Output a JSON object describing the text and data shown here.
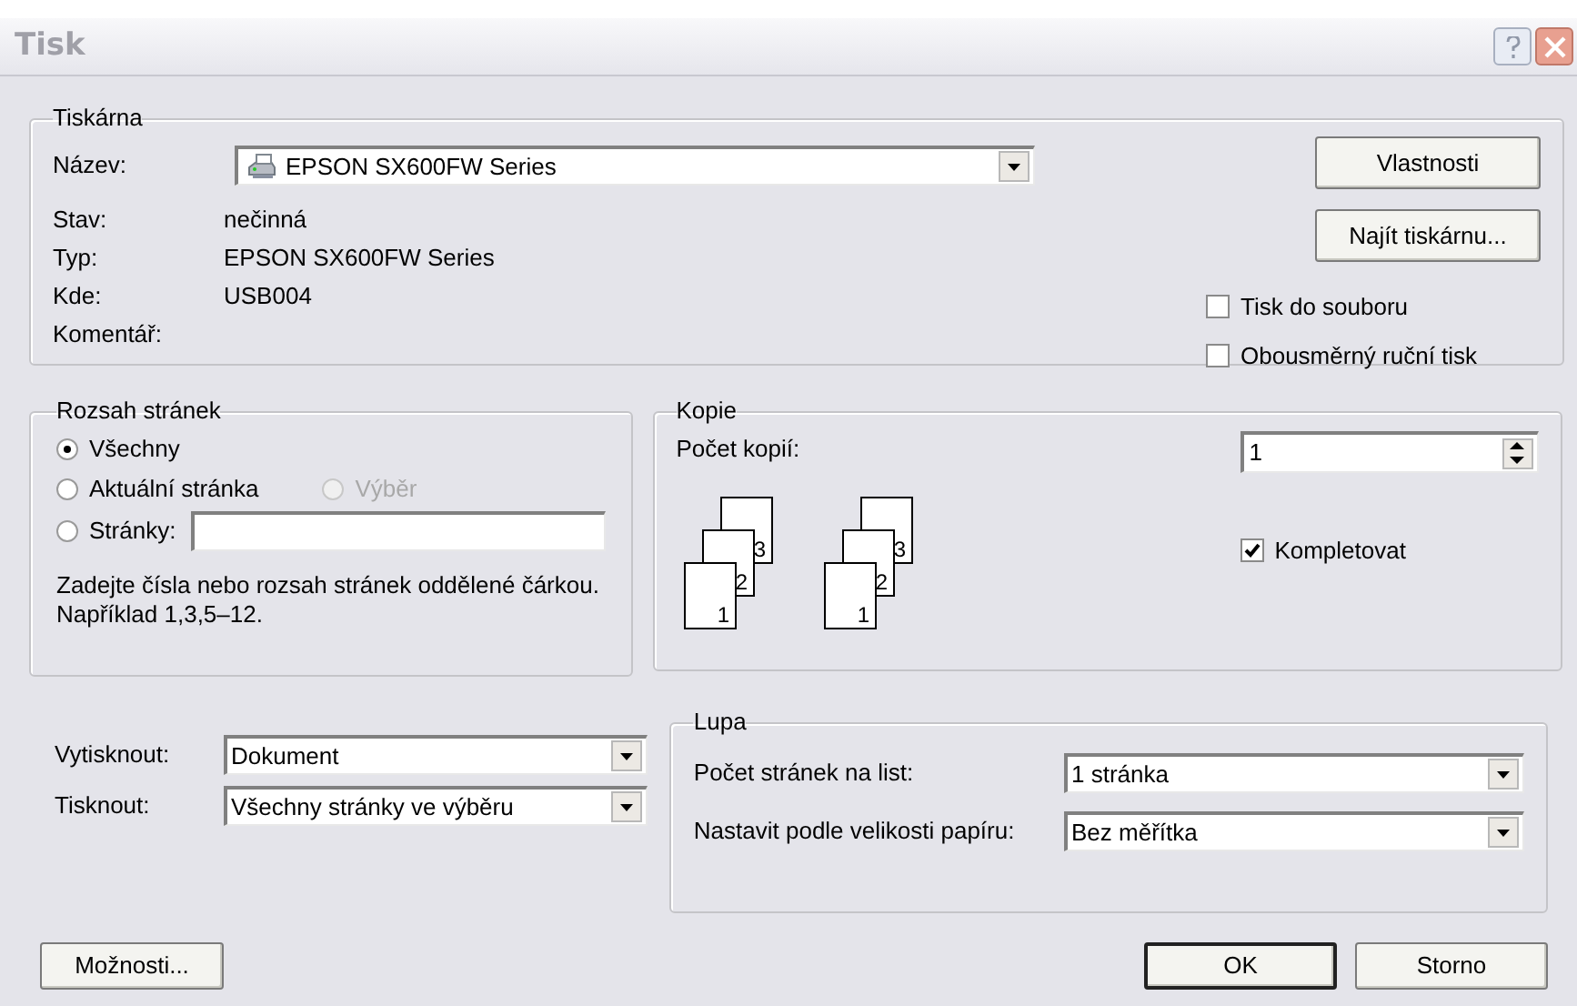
{
  "window": {
    "title": "Tisk"
  },
  "printer": {
    "legend": "Tiskárna",
    "name_label": "Název:",
    "name_value": "EPSON SX600FW Series",
    "info": [
      {
        "label": "Stav:",
        "value": "nečinná"
      },
      {
        "label": "Typ:",
        "value": "EPSON SX600FW Series"
      },
      {
        "label": "Kde:",
        "value": "USB004"
      },
      {
        "label": "Komentář:"
      }
    ],
    "buttons": [
      "Vlastnosti",
      "Najít tiskárnu..."
    ],
    "options": [
      {
        "label": "Tisk do souboru",
        "checked": false
      },
      {
        "label": "Obousměrný ruční tisk",
        "checked": false
      }
    ]
  },
  "page_range": {
    "legend": "Rozsah stránek",
    "options": [
      {
        "label": "Všechny",
        "selected": true,
        "disabled": false
      },
      {
        "label": "Aktuální stránka",
        "selected": false,
        "disabled": false
      },
      {
        "label": "Výběr",
        "selected": false,
        "disabled": true
      },
      {
        "label": "Stránky:",
        "selected": false,
        "disabled": false
      }
    ],
    "hint": "Zadejte čísla nebo rozsah stránek oddělené čárkou. Například 1,3,5–12."
  },
  "copies": {
    "legend": "Kopie",
    "count_label": "Počet kopií:",
    "count_value": "1",
    "stacks": [
      {
        "pages": [
          "1",
          "2",
          "3"
        ]
      },
      {
        "pages": [
          "1",
          "2",
          "3"
        ]
      }
    ],
    "collate": {
      "label": "Kompletovat",
      "checked": true
    }
  },
  "print_what": [
    {
      "label": "Vytisknout:",
      "value": "Dokument"
    },
    {
      "label": "Tisknout:",
      "value": "Všechny stránky ve výběru"
    }
  ],
  "zoom": {
    "legend": "Lupa",
    "rows": [
      {
        "label": "Počet stránek na list:",
        "value": "1 stránka"
      },
      {
        "label": "Nastavit podle velikosti papíru:",
        "value": "Bez měřítka"
      }
    ]
  },
  "buttons": [
    {
      "label": "Možnosti...",
      "default": false
    },
    {
      "label": "OK",
      "default": true
    },
    {
      "label": "Storno",
      "default": false
    }
  ]
}
